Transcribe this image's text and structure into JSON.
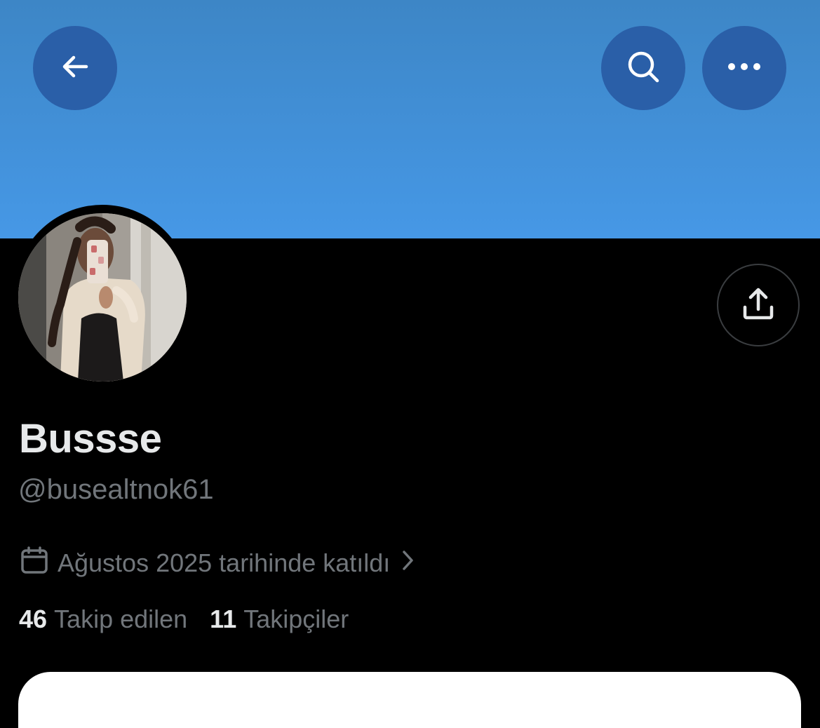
{
  "header": {
    "back_icon": "arrow-left-icon",
    "search_icon": "search-icon",
    "more_icon": "more-horizontal-icon",
    "banner_color": "#4698e6",
    "button_color": "#2a5fa8"
  },
  "profile": {
    "display_name": "Bussse",
    "handle": "@busealtnok61",
    "joined_text": "Ağustos 2025 tarihinde katıldı",
    "share_icon": "share-icon"
  },
  "stats": [
    {
      "count": "46",
      "label": "Takip edilen"
    },
    {
      "count": "11",
      "label": "Takipçiler"
    }
  ]
}
